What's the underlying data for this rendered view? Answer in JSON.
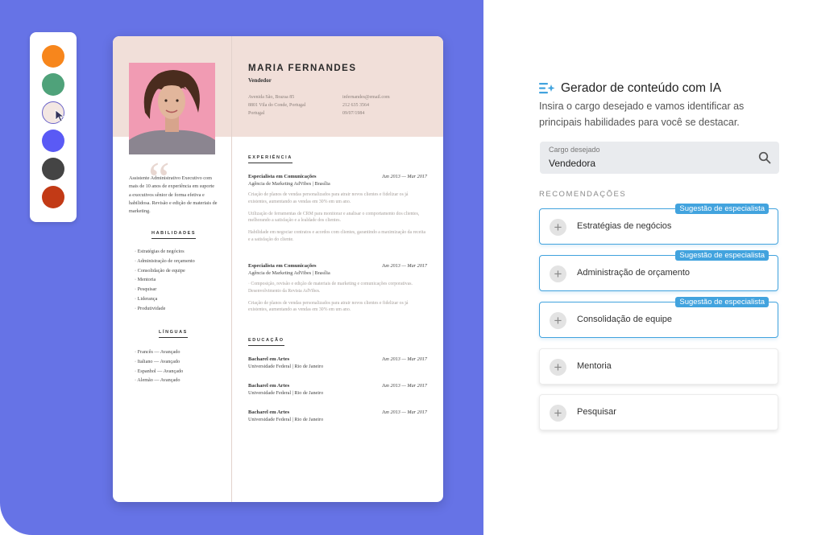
{
  "palette": {
    "colors": [
      "#f7861c",
      "#4fa27a",
      "#f3e7e3",
      "#5a5af5",
      "#444444",
      "#c23a16"
    ],
    "selected_index": 2
  },
  "resume": {
    "name": "MARIA FERNANDES",
    "role": "Vendedor",
    "address": [
      "Avenida São, Brazsa 85",
      "8801 Vila do Conde, Portugal",
      "Portugal"
    ],
    "contact": [
      "infernandes@email.com",
      "212 635 3564",
      "09/07/1984"
    ],
    "summary": "Assistente Administrativo Executivo com mais de 10 anos de experiência em suporte a executivos sênior de forma efetiva e habilidosa. Revisão e edição de materiais de marketing.",
    "skills_title": "HABILIDADES",
    "skills": [
      "· Estratégias de negócios",
      "· Administração de orçamento",
      "· Consolidação de equipe",
      "· Mentoria",
      "· Pesquisar",
      "· Liderança",
      "· Produtividade"
    ],
    "languages_title": "LÍNGUAS",
    "languages": [
      "· Francês — Avançado",
      "· Italiano — Avançado",
      "· Espanhol — Avançado",
      "· Alemão — Avançado"
    ],
    "experience_title": "EXPERIÊNCIA",
    "jobs": [
      {
        "title": "Especialista em Comunicações",
        "company": "Agência de Marketing AdVibes | Brasília",
        "date": "Jun 2013 — Mar 2017",
        "bullets": [
          "Criação de planos de vendas personalizados para atrair novos clientes e fidelizar os já existentes, aumentando as vendas em 30% em um ano.",
          "Utilização de ferramentas de CRM para monitorar e analisar o comportamento dos clientes, melhorando a satisfação e a lealdade dos clientes.",
          "Habilidade em negociar contratos e acordos com clientes, garantindo a maximização da receita e a satisfação do cliente."
        ]
      },
      {
        "title": "Especialista em Comunicações",
        "company": "Agência de Marketing AdVibes | Brasília",
        "date": "Jun 2013 — Mar 2017",
        "bullets": [
          "· Composição, revisão e edição de materiais de marketing e comunicações corporativas. Desenvolvimento da Revista AdVibes.",
          "Criação de planos de vendas personalizados para atrair novos clientes e fidelizar os já existentes, aumentando as vendas em 30% em um ano."
        ]
      }
    ],
    "education_title": "EDUCAÇÃO",
    "education": [
      {
        "degree": "Bacharel em Artes",
        "school": "Universidade Federal | Rio de Janeiro",
        "date": "Jun 2013 — Mar 2017"
      },
      {
        "degree": "Bacharel em Artes",
        "school": "Universidade Federal | Rio de Janeiro",
        "date": "Jun 2013 — Mar 2017"
      },
      {
        "degree": "Bacharel em Artes",
        "school": "Universidade Federal | Rio de Janeiro",
        "date": "Jun 2013 — Mar 2017"
      }
    ]
  },
  "panel": {
    "title": "Gerador de conteúdo com IA",
    "subtitle": "Insira o cargo desejado e vamos identificar as principais habilidades para você se destacar.",
    "search": {
      "label": "Cargo desejado",
      "value": "Vendedora"
    },
    "recommendations_title": "RECOMENDAÇÕES",
    "expert_badge": "Sugestão de especialista",
    "recommendations": [
      {
        "label": "Estratégias de negócios",
        "expert": true
      },
      {
        "label": "Administração de orçamento",
        "expert": true
      },
      {
        "label": "Consolidação de equipe",
        "expert": true
      },
      {
        "label": "Mentoria",
        "expert": false
      },
      {
        "label": "Pesquisar",
        "expert": false
      }
    ]
  },
  "colors": {
    "background": "#6673e6",
    "accent": "#42a3de",
    "resume_header": "#f1dfd9"
  }
}
